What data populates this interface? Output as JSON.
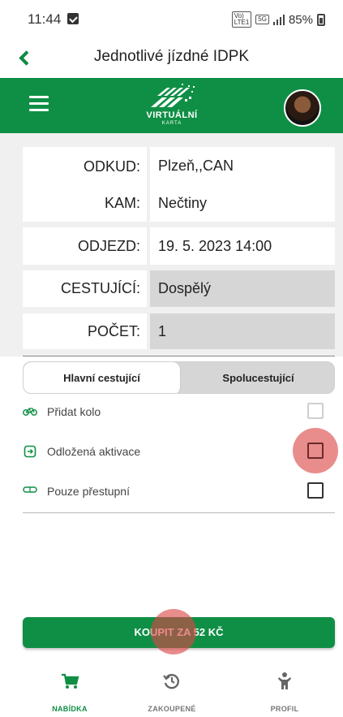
{
  "status_bar": {
    "time": "11:44",
    "network_tag_top": "Vo)",
    "network_tag_bottom": "LTE1",
    "network_type": "5G",
    "battery": "85%"
  },
  "title_bar": {
    "title": "Jednotlivé jízdné IDPK"
  },
  "header": {
    "logo_text": "VIRTUÁLNÍ",
    "logo_subtext": "KARTA"
  },
  "form": {
    "from_label": "ODKUD:",
    "from_value": "Plzeň,,CAN",
    "to_label": "KAM:",
    "to_value": "Nečtiny",
    "departure_label": "ODJEZD:",
    "departure_value": "19. 5. 2023 14:00",
    "passenger_label": "CESTUJÍCÍ:",
    "passenger_value": "Dospělý",
    "count_label": "POČET:",
    "count_value": "1"
  },
  "tabs": [
    {
      "label": "Hlavní cestující",
      "active": true
    },
    {
      "label": "Spolucestující",
      "active": false
    }
  ],
  "options": [
    {
      "label": "Přidat kolo",
      "icon": "bicycle-icon",
      "checked": false,
      "enabled": false
    },
    {
      "label": "Odložená aktivace",
      "icon": "delayed-activation-icon",
      "checked": false,
      "enabled": true
    },
    {
      "label": "Pouze přestupní",
      "icon": "transfer-icon",
      "checked": false,
      "enabled": true
    }
  ],
  "buy_button": {
    "label": "KOUPIT ZA 52 KČ"
  },
  "bottom_nav": [
    {
      "label": "NABÍDKA",
      "icon": "cart-icon",
      "active": true
    },
    {
      "label": "ZAKOUPENÉ",
      "icon": "history-icon",
      "active": false
    },
    {
      "label": "PROFIL",
      "icon": "person-icon",
      "active": false
    }
  ],
  "colors": {
    "primary_green": "#0f8f45",
    "readonly_field": "#d6d6d6",
    "touch_ripple": "#e05a5a"
  }
}
